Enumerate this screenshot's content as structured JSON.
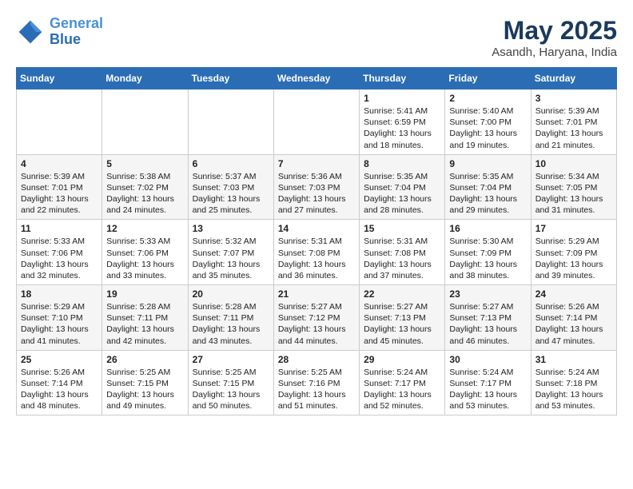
{
  "header": {
    "logo_line1": "General",
    "logo_line2": "Blue",
    "month": "May 2025",
    "location": "Asandh, Haryana, India"
  },
  "weekdays": [
    "Sunday",
    "Monday",
    "Tuesday",
    "Wednesday",
    "Thursday",
    "Friday",
    "Saturday"
  ],
  "weeks": [
    [
      {
        "day": "",
        "info": ""
      },
      {
        "day": "",
        "info": ""
      },
      {
        "day": "",
        "info": ""
      },
      {
        "day": "",
        "info": ""
      },
      {
        "day": "1",
        "info": "Sunrise: 5:41 AM\nSunset: 6:59 PM\nDaylight: 13 hours\nand 18 minutes."
      },
      {
        "day": "2",
        "info": "Sunrise: 5:40 AM\nSunset: 7:00 PM\nDaylight: 13 hours\nand 19 minutes."
      },
      {
        "day": "3",
        "info": "Sunrise: 5:39 AM\nSunset: 7:01 PM\nDaylight: 13 hours\nand 21 minutes."
      }
    ],
    [
      {
        "day": "4",
        "info": "Sunrise: 5:39 AM\nSunset: 7:01 PM\nDaylight: 13 hours\nand 22 minutes."
      },
      {
        "day": "5",
        "info": "Sunrise: 5:38 AM\nSunset: 7:02 PM\nDaylight: 13 hours\nand 24 minutes."
      },
      {
        "day": "6",
        "info": "Sunrise: 5:37 AM\nSunset: 7:03 PM\nDaylight: 13 hours\nand 25 minutes."
      },
      {
        "day": "7",
        "info": "Sunrise: 5:36 AM\nSunset: 7:03 PM\nDaylight: 13 hours\nand 27 minutes."
      },
      {
        "day": "8",
        "info": "Sunrise: 5:35 AM\nSunset: 7:04 PM\nDaylight: 13 hours\nand 28 minutes."
      },
      {
        "day": "9",
        "info": "Sunrise: 5:35 AM\nSunset: 7:04 PM\nDaylight: 13 hours\nand 29 minutes."
      },
      {
        "day": "10",
        "info": "Sunrise: 5:34 AM\nSunset: 7:05 PM\nDaylight: 13 hours\nand 31 minutes."
      }
    ],
    [
      {
        "day": "11",
        "info": "Sunrise: 5:33 AM\nSunset: 7:06 PM\nDaylight: 13 hours\nand 32 minutes."
      },
      {
        "day": "12",
        "info": "Sunrise: 5:33 AM\nSunset: 7:06 PM\nDaylight: 13 hours\nand 33 minutes."
      },
      {
        "day": "13",
        "info": "Sunrise: 5:32 AM\nSunset: 7:07 PM\nDaylight: 13 hours\nand 35 minutes."
      },
      {
        "day": "14",
        "info": "Sunrise: 5:31 AM\nSunset: 7:08 PM\nDaylight: 13 hours\nand 36 minutes."
      },
      {
        "day": "15",
        "info": "Sunrise: 5:31 AM\nSunset: 7:08 PM\nDaylight: 13 hours\nand 37 minutes."
      },
      {
        "day": "16",
        "info": "Sunrise: 5:30 AM\nSunset: 7:09 PM\nDaylight: 13 hours\nand 38 minutes."
      },
      {
        "day": "17",
        "info": "Sunrise: 5:29 AM\nSunset: 7:09 PM\nDaylight: 13 hours\nand 39 minutes."
      }
    ],
    [
      {
        "day": "18",
        "info": "Sunrise: 5:29 AM\nSunset: 7:10 PM\nDaylight: 13 hours\nand 41 minutes."
      },
      {
        "day": "19",
        "info": "Sunrise: 5:28 AM\nSunset: 7:11 PM\nDaylight: 13 hours\nand 42 minutes."
      },
      {
        "day": "20",
        "info": "Sunrise: 5:28 AM\nSunset: 7:11 PM\nDaylight: 13 hours\nand 43 minutes."
      },
      {
        "day": "21",
        "info": "Sunrise: 5:27 AM\nSunset: 7:12 PM\nDaylight: 13 hours\nand 44 minutes."
      },
      {
        "day": "22",
        "info": "Sunrise: 5:27 AM\nSunset: 7:13 PM\nDaylight: 13 hours\nand 45 minutes."
      },
      {
        "day": "23",
        "info": "Sunrise: 5:27 AM\nSunset: 7:13 PM\nDaylight: 13 hours\nand 46 minutes."
      },
      {
        "day": "24",
        "info": "Sunrise: 5:26 AM\nSunset: 7:14 PM\nDaylight: 13 hours\nand 47 minutes."
      }
    ],
    [
      {
        "day": "25",
        "info": "Sunrise: 5:26 AM\nSunset: 7:14 PM\nDaylight: 13 hours\nand 48 minutes."
      },
      {
        "day": "26",
        "info": "Sunrise: 5:25 AM\nSunset: 7:15 PM\nDaylight: 13 hours\nand 49 minutes."
      },
      {
        "day": "27",
        "info": "Sunrise: 5:25 AM\nSunset: 7:15 PM\nDaylight: 13 hours\nand 50 minutes."
      },
      {
        "day": "28",
        "info": "Sunrise: 5:25 AM\nSunset: 7:16 PM\nDaylight: 13 hours\nand 51 minutes."
      },
      {
        "day": "29",
        "info": "Sunrise: 5:24 AM\nSunset: 7:17 PM\nDaylight: 13 hours\nand 52 minutes."
      },
      {
        "day": "30",
        "info": "Sunrise: 5:24 AM\nSunset: 7:17 PM\nDaylight: 13 hours\nand 53 minutes."
      },
      {
        "day": "31",
        "info": "Sunrise: 5:24 AM\nSunset: 7:18 PM\nDaylight: 13 hours\nand 53 minutes."
      }
    ]
  ]
}
